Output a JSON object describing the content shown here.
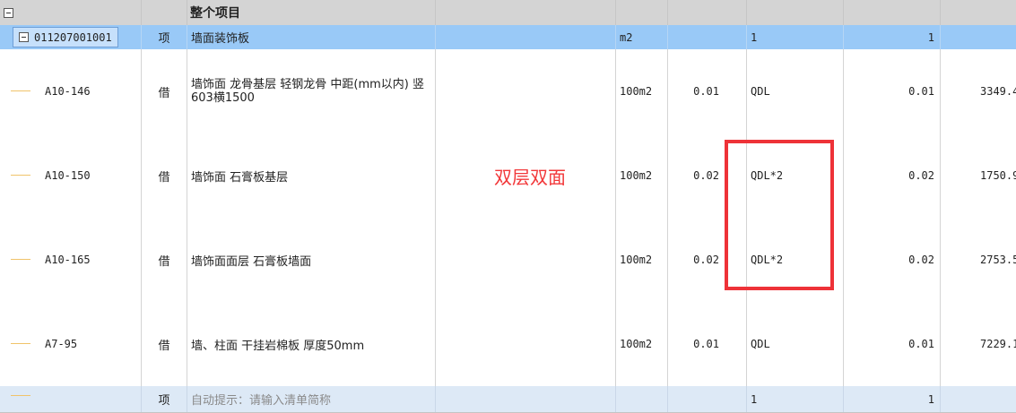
{
  "header": {
    "title": "整个项目"
  },
  "main_row": {
    "code": "011207001001",
    "category": "项",
    "name": "墙面装饰板",
    "unit": "m2",
    "qty_expr": "1",
    "qty": "1"
  },
  "rows": [
    {
      "code": "A10-146",
      "category": "借",
      "name": "墙饰面 龙骨基层 轻钢龙骨 中距(mm以内) 竖603横1500",
      "unit": "100m2",
      "content": "0.01",
      "qty_expr": "QDL",
      "qty": "0.01",
      "price": "3349.4"
    },
    {
      "code": "A10-150",
      "category": "借",
      "name": "墙饰面 石膏板基层",
      "unit": "100m2",
      "content": "0.02",
      "qty_expr": "QDL*2",
      "qty": "0.02",
      "price": "1750.9"
    },
    {
      "code": "A10-165",
      "category": "借",
      "name": "墙饰面面层 石膏板墙面",
      "unit": "100m2",
      "content": "0.02",
      "qty_expr": "QDL*2",
      "qty": "0.02",
      "price": "2753.5"
    },
    {
      "code": "A7-95",
      "category": "借",
      "name": "墙、柱面 干挂岩棉板 厚度50mm",
      "unit": "100m2",
      "content": "0.01",
      "qty_expr": "QDL",
      "qty": "0.01",
      "price": "7229.1"
    }
  ],
  "last_row": {
    "category": "项",
    "placeholder": "自动提示：请输入清单简称",
    "qty_expr": "1",
    "qty": "1"
  },
  "annotation": {
    "text": "双层双面",
    "color": "#f2383a"
  }
}
